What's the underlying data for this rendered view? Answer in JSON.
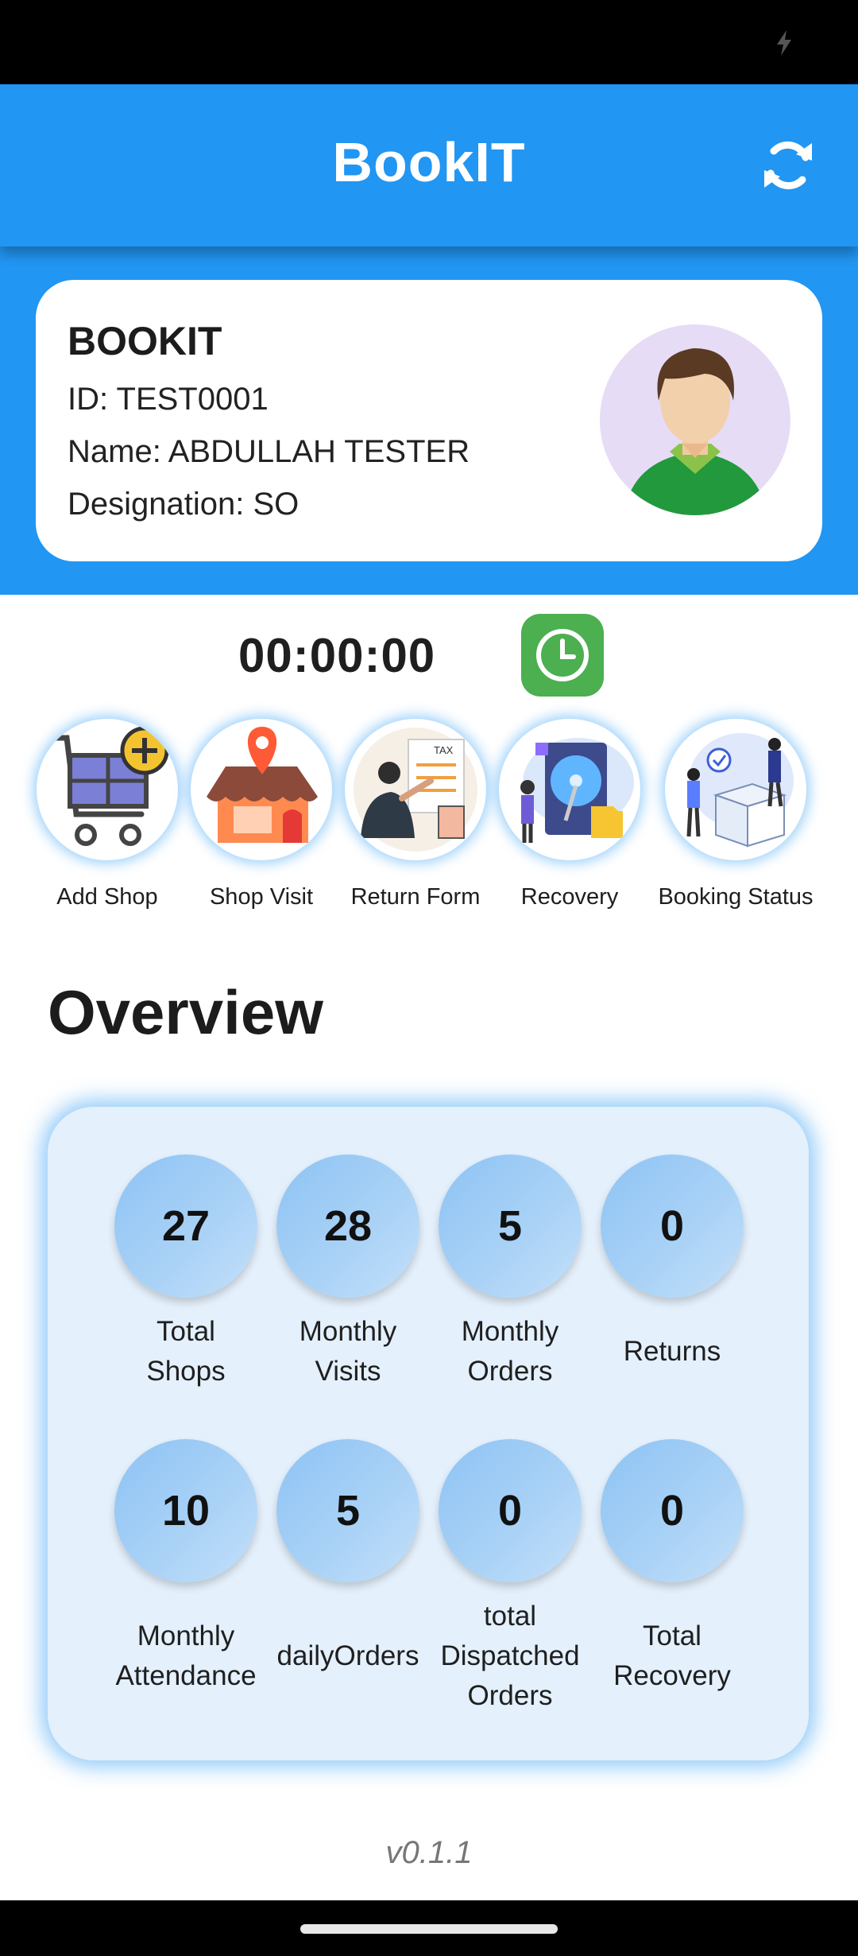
{
  "app": {
    "title": "BookIT"
  },
  "profile": {
    "company": "BOOKIT",
    "id_line": "ID: TEST0001",
    "name_line": "Name: ABDULLAH TESTER",
    "designation_line": "Designation: SO"
  },
  "timer": {
    "value": "00:00:00"
  },
  "actions": [
    {
      "label": "Add Shop",
      "icon": "cart-add-icon"
    },
    {
      "label": "Shop Visit",
      "icon": "shop-location-icon"
    },
    {
      "label": "Return Form",
      "icon": "tax-return-icon"
    },
    {
      "label": "Recovery",
      "icon": "disk-recovery-icon"
    },
    {
      "label": "Booking Status",
      "icon": "delivery-box-icon"
    }
  ],
  "overview": {
    "title": "Overview",
    "stats": [
      {
        "value": "27",
        "label_l1": "Total",
        "label_l2": "Shops",
        "label_l3": ""
      },
      {
        "value": "28",
        "label_l1": "Monthly",
        "label_l2": "Visits",
        "label_l3": ""
      },
      {
        "value": "5",
        "label_l1": "Monthly",
        "label_l2": "Orders",
        "label_l3": ""
      },
      {
        "value": "0",
        "label_l1": "Returns",
        "label_l2": "",
        "label_l3": ""
      },
      {
        "value": "10",
        "label_l1": "Monthly",
        "label_l2": "Attendance",
        "label_l3": ""
      },
      {
        "value": "5",
        "label_l1": "dailyOrders",
        "label_l2": "",
        "label_l3": ""
      },
      {
        "value": "0",
        "label_l1": "total",
        "label_l2": "Dispatched",
        "label_l3": "Orders"
      },
      {
        "value": "0",
        "label_l1": "Total",
        "label_l2": "Recovery",
        "label_l3": ""
      }
    ]
  },
  "footer": {
    "version": "v0.1.1"
  },
  "colors": {
    "primary": "#2196F3",
    "clock_button": "#4CAF50",
    "stats_bg": "#e4f0fc"
  }
}
